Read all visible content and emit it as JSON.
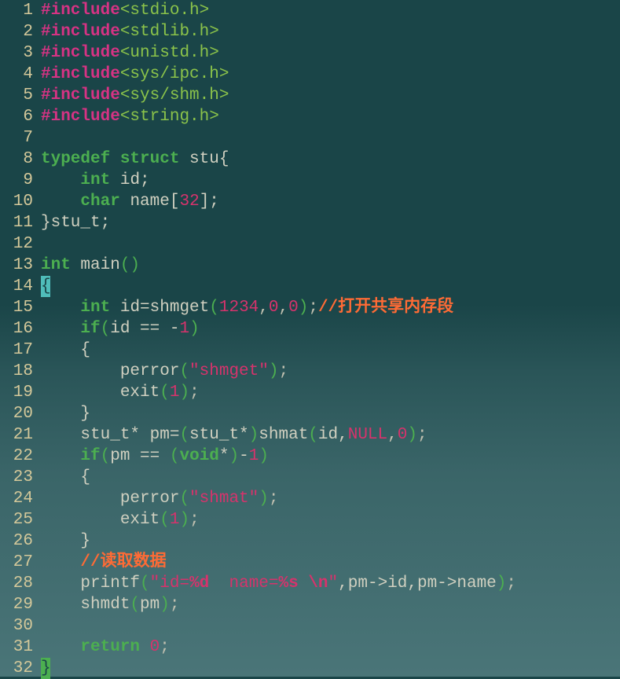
{
  "code_lines": [
    {
      "num": 1,
      "tokens": [
        {
          "t": "#include",
          "c": "preproc"
        },
        {
          "t": "<stdio.h>",
          "c": "include"
        }
      ]
    },
    {
      "num": 2,
      "tokens": [
        {
          "t": "#include",
          "c": "preproc"
        },
        {
          "t": "<stdlib.h>",
          "c": "include"
        }
      ]
    },
    {
      "num": 3,
      "tokens": [
        {
          "t": "#include",
          "c": "preproc"
        },
        {
          "t": "<unistd.h>",
          "c": "include"
        }
      ]
    },
    {
      "num": 4,
      "tokens": [
        {
          "t": "#include",
          "c": "preproc"
        },
        {
          "t": "<sys/ipc.h>",
          "c": "include"
        }
      ]
    },
    {
      "num": 5,
      "tokens": [
        {
          "t": "#include",
          "c": "preproc"
        },
        {
          "t": "<sys/shm.h>",
          "c": "include"
        }
      ]
    },
    {
      "num": 6,
      "tokens": [
        {
          "t": "#include",
          "c": "preproc"
        },
        {
          "t": "<string.h>",
          "c": "include"
        }
      ]
    },
    {
      "num": 7,
      "tokens": []
    },
    {
      "num": 8,
      "tokens": [
        {
          "t": "typedef",
          "c": "keyword"
        },
        {
          "t": " ",
          "c": "punct"
        },
        {
          "t": "struct",
          "c": "keyword"
        },
        {
          "t": " stu{",
          "c": "ident"
        }
      ]
    },
    {
      "num": 9,
      "tokens": [
        {
          "t": "    ",
          "c": "punct"
        },
        {
          "t": "int",
          "c": "type"
        },
        {
          "t": " id;",
          "c": "ident"
        }
      ]
    },
    {
      "num": 10,
      "tokens": [
        {
          "t": "    ",
          "c": "punct"
        },
        {
          "t": "char",
          "c": "type"
        },
        {
          "t": " name[",
          "c": "ident"
        },
        {
          "t": "32",
          "c": "number"
        },
        {
          "t": "];",
          "c": "ident"
        }
      ]
    },
    {
      "num": 11,
      "tokens": [
        {
          "t": "}stu_t;",
          "c": "ident"
        }
      ]
    },
    {
      "num": 12,
      "tokens": []
    },
    {
      "num": 13,
      "tokens": [
        {
          "t": "int",
          "c": "type"
        },
        {
          "t": " main",
          "c": "ident"
        },
        {
          "t": "()",
          "c": "paren"
        }
      ]
    },
    {
      "num": 14,
      "tokens": [
        {
          "t": "{",
          "c": "cursor-open"
        }
      ]
    },
    {
      "num": 15,
      "tokens": [
        {
          "t": "    ",
          "c": "punct"
        },
        {
          "t": "int",
          "c": "type"
        },
        {
          "t": " id=shmget",
          "c": "ident"
        },
        {
          "t": "(",
          "c": "paren"
        },
        {
          "t": "1234",
          "c": "number"
        },
        {
          "t": ",",
          "c": "punct"
        },
        {
          "t": "0",
          "c": "number"
        },
        {
          "t": ",",
          "c": "punct"
        },
        {
          "t": "0",
          "c": "number"
        },
        {
          "t": ")",
          "c": "paren"
        },
        {
          "t": ";",
          "c": "punct"
        },
        {
          "t": "//打开共享内存段",
          "c": "comment"
        }
      ]
    },
    {
      "num": 16,
      "tokens": [
        {
          "t": "    ",
          "c": "punct"
        },
        {
          "t": "if",
          "c": "keyword"
        },
        {
          "t": "(",
          "c": "paren"
        },
        {
          "t": "id == -",
          "c": "ident"
        },
        {
          "t": "1",
          "c": "number"
        },
        {
          "t": ")",
          "c": "paren"
        }
      ]
    },
    {
      "num": 17,
      "tokens": [
        {
          "t": "    {",
          "c": "ident"
        }
      ]
    },
    {
      "num": 18,
      "tokens": [
        {
          "t": "        perror",
          "c": "ident"
        },
        {
          "t": "(",
          "c": "paren"
        },
        {
          "t": "\"shmget\"",
          "c": "string"
        },
        {
          "t": ")",
          "c": "paren"
        },
        {
          "t": ";",
          "c": "punct"
        }
      ]
    },
    {
      "num": 19,
      "tokens": [
        {
          "t": "        exit",
          "c": "ident"
        },
        {
          "t": "(",
          "c": "paren"
        },
        {
          "t": "1",
          "c": "number"
        },
        {
          "t": ")",
          "c": "paren"
        },
        {
          "t": ";",
          "c": "punct"
        }
      ]
    },
    {
      "num": 20,
      "tokens": [
        {
          "t": "    }",
          "c": "ident"
        }
      ]
    },
    {
      "num": 21,
      "tokens": [
        {
          "t": "    stu_t* pm=",
          "c": "ident"
        },
        {
          "t": "(",
          "c": "paren"
        },
        {
          "t": "stu_t*",
          "c": "ident"
        },
        {
          "t": ")",
          "c": "paren"
        },
        {
          "t": "shmat",
          "c": "ident"
        },
        {
          "t": "(",
          "c": "paren"
        },
        {
          "t": "id,",
          "c": "ident"
        },
        {
          "t": "NULL",
          "c": "null"
        },
        {
          "t": ",",
          "c": "punct"
        },
        {
          "t": "0",
          "c": "number"
        },
        {
          "t": ")",
          "c": "paren"
        },
        {
          "t": ";",
          "c": "punct"
        }
      ]
    },
    {
      "num": 22,
      "tokens": [
        {
          "t": "    ",
          "c": "punct"
        },
        {
          "t": "if",
          "c": "keyword"
        },
        {
          "t": "(",
          "c": "paren"
        },
        {
          "t": "pm == ",
          "c": "ident"
        },
        {
          "t": "(",
          "c": "paren"
        },
        {
          "t": "void",
          "c": "void"
        },
        {
          "t": "*",
          "c": "ident"
        },
        {
          "t": ")",
          "c": "paren"
        },
        {
          "t": "-",
          "c": "ident"
        },
        {
          "t": "1",
          "c": "number"
        },
        {
          "t": ")",
          "c": "paren"
        }
      ]
    },
    {
      "num": 23,
      "tokens": [
        {
          "t": "    {",
          "c": "ident"
        }
      ]
    },
    {
      "num": 24,
      "tokens": [
        {
          "t": "        perror",
          "c": "ident"
        },
        {
          "t": "(",
          "c": "paren"
        },
        {
          "t": "\"shmat\"",
          "c": "string"
        },
        {
          "t": ")",
          "c": "paren"
        },
        {
          "t": ";",
          "c": "punct"
        }
      ]
    },
    {
      "num": 25,
      "tokens": [
        {
          "t": "        exit",
          "c": "ident"
        },
        {
          "t": "(",
          "c": "paren"
        },
        {
          "t": "1",
          "c": "number"
        },
        {
          "t": ")",
          "c": "paren"
        },
        {
          "t": ";",
          "c": "punct"
        }
      ]
    },
    {
      "num": 26,
      "tokens": [
        {
          "t": "    }",
          "c": "ident"
        }
      ]
    },
    {
      "num": 27,
      "tokens": [
        {
          "t": "    ",
          "c": "punct"
        },
        {
          "t": "//读取数据",
          "c": "comment"
        }
      ]
    },
    {
      "num": 28,
      "tokens": [
        {
          "t": "    printf",
          "c": "ident"
        },
        {
          "t": "(",
          "c": "paren"
        },
        {
          "t": "\"id=",
          "c": "string"
        },
        {
          "t": "%d",
          "c": "format"
        },
        {
          "t": "  name=",
          "c": "string"
        },
        {
          "t": "%s",
          "c": "format"
        },
        {
          "t": " ",
          "c": "string"
        },
        {
          "t": "\\n",
          "c": "escape"
        },
        {
          "t": "\"",
          "c": "string"
        },
        {
          "t": ",pm->id,pm->name",
          "c": "ident"
        },
        {
          "t": ")",
          "c": "paren"
        },
        {
          "t": ";",
          "c": "punct"
        }
      ]
    },
    {
      "num": 29,
      "tokens": [
        {
          "t": "    shmdt",
          "c": "ident"
        },
        {
          "t": "(",
          "c": "paren"
        },
        {
          "t": "pm",
          "c": "ident"
        },
        {
          "t": ")",
          "c": "paren"
        },
        {
          "t": ";",
          "c": "punct"
        }
      ]
    },
    {
      "num": 30,
      "tokens": []
    },
    {
      "num": 31,
      "tokens": [
        {
          "t": "    ",
          "c": "punct"
        },
        {
          "t": "return",
          "c": "keyword"
        },
        {
          "t": " ",
          "c": "punct"
        },
        {
          "t": "0",
          "c": "number"
        },
        {
          "t": ";",
          "c": "punct"
        }
      ]
    },
    {
      "num": 32,
      "tokens": [
        {
          "t": "}",
          "c": "cursor-close"
        }
      ]
    }
  ]
}
